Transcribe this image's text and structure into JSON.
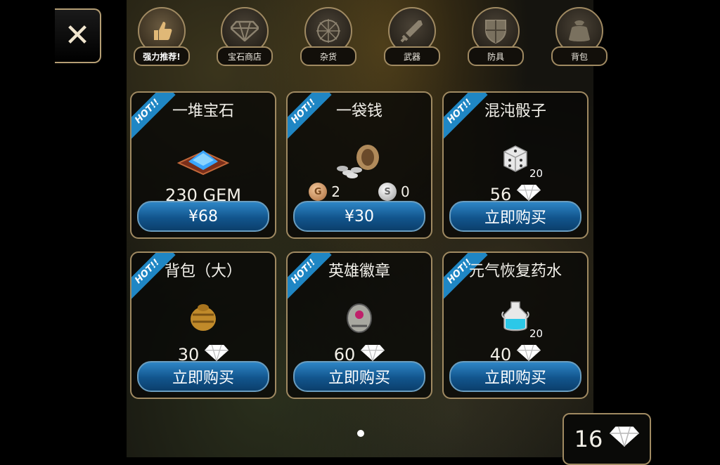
{
  "close_label": "✕",
  "tabs": [
    {
      "label": "强力推荐!",
      "icon": "thumbs-up-icon",
      "active": true
    },
    {
      "label": "宝石商店",
      "icon": "gem-icon",
      "active": false
    },
    {
      "label": "杂货",
      "icon": "compass-icon",
      "active": false
    },
    {
      "label": "武器",
      "icon": "sword-icon",
      "active": false
    },
    {
      "label": "防具",
      "icon": "shield-icon",
      "active": false
    },
    {
      "label": "背包",
      "icon": "bag-icon",
      "active": false
    }
  ],
  "hot_label": "HOT!!",
  "items": [
    {
      "title": "一堆宝石",
      "price_text": "230 GEM",
      "button": "¥68",
      "icon": "gem-pile-icon"
    },
    {
      "title": "一袋钱",
      "copper": "2",
      "silver": "0",
      "button": "¥30",
      "icon": "money-bag-icon"
    },
    {
      "title": "混沌骰子",
      "count": "20",
      "price": "56",
      "button": "立即购买",
      "icon": "dice-icon"
    },
    {
      "title": "背包（大）",
      "price": "30",
      "button": "立即购买",
      "icon": "backpack-icon"
    },
    {
      "title": "英雄徽章",
      "price": "60",
      "button": "立即购买",
      "icon": "badge-icon"
    },
    {
      "title": "元气恢复药水",
      "count": "20",
      "price": "40",
      "button": "立即购买",
      "icon": "potion-icon"
    }
  ],
  "gem_balance": "16",
  "colors": {
    "accent_blue": "#1f86c4",
    "frame": "#a08a62"
  }
}
